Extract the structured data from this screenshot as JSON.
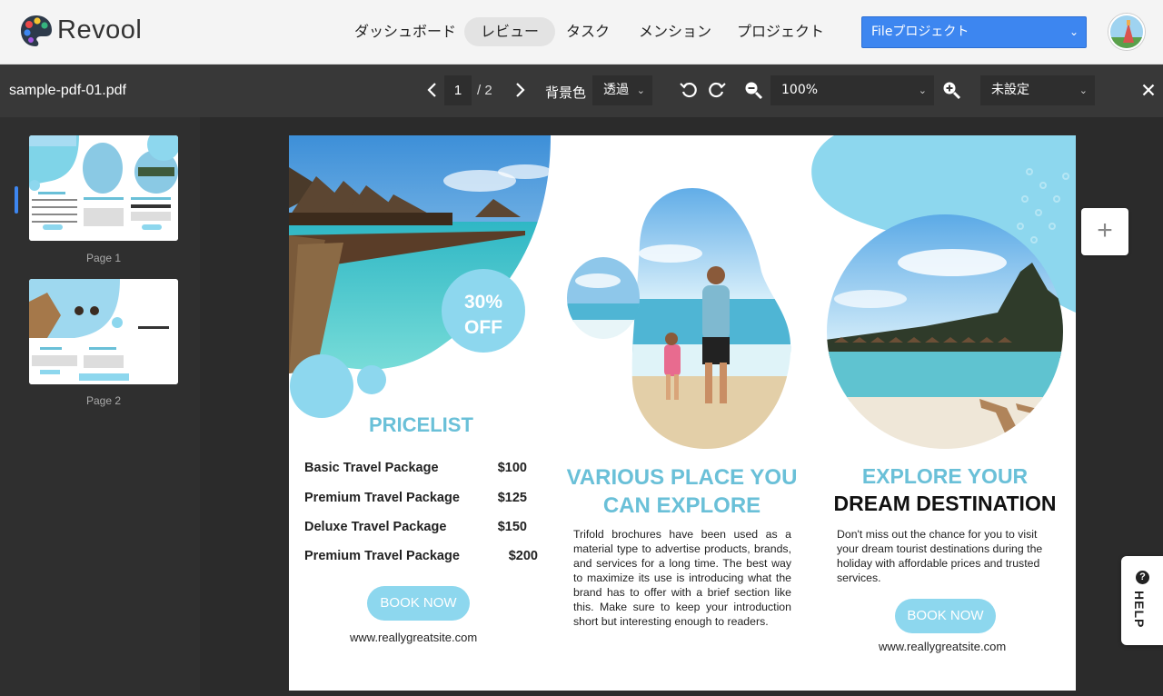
{
  "app": {
    "brand": "Revool",
    "nav": [
      "ダッシュボード",
      "レビュー",
      "タスク",
      "メンション",
      "プロジェクト"
    ],
    "project_select": "Fileプロジェクト"
  },
  "toolbar": {
    "filename": "sample-pdf-01.pdf",
    "current_page": "1",
    "total_pages": "/ 2",
    "background_label": "背景色",
    "background_value": "透過",
    "zoom_value": "100%",
    "status_value": "未設定"
  },
  "sidebar": {
    "pages": [
      {
        "label": "Page 1"
      },
      {
        "label": "Page 2"
      }
    ]
  },
  "brochure": {
    "badge_line1": "30%",
    "badge_line2": "OFF",
    "pricelist_title": "PRICELIST",
    "prices": [
      {
        "name": "Basic Travel Package",
        "amount": "$100"
      },
      {
        "name": "Premium Travel Package",
        "amount": "$125"
      },
      {
        "name": "Deluxe Travel Package",
        "amount": "$150"
      },
      {
        "name": "Premium Travel Package",
        "amount": "$200"
      }
    ],
    "book_now": "BOOK NOW",
    "site": "www.reallygreatsite.com",
    "middle_title_line1": "VARIOUS PLACE YOU",
    "middle_title_line2": "CAN EXPLORE",
    "middle_para": "Trifold brochures have been used as a material type to advertise products, brands, and services for a long time. The best way to maximize its use is introducing what the brand has to offer with a brief section like this. Make sure to keep your introduction short but interesting enough to readers.",
    "right_title_line1": "EXPLORE YOUR",
    "right_title_line2": "DREAM DESTINATION",
    "right_para": "Don't miss out the chance for you to visit your dream tourist destinations during the holiday with affordable prices and trusted services."
  },
  "help": {
    "label": "HELP",
    "icon_glyph": "?"
  },
  "add_button": "+",
  "colors": {
    "accent": "#3d86f0",
    "teal": "#6ac0d8",
    "light_blue": "#8dd7ee"
  }
}
